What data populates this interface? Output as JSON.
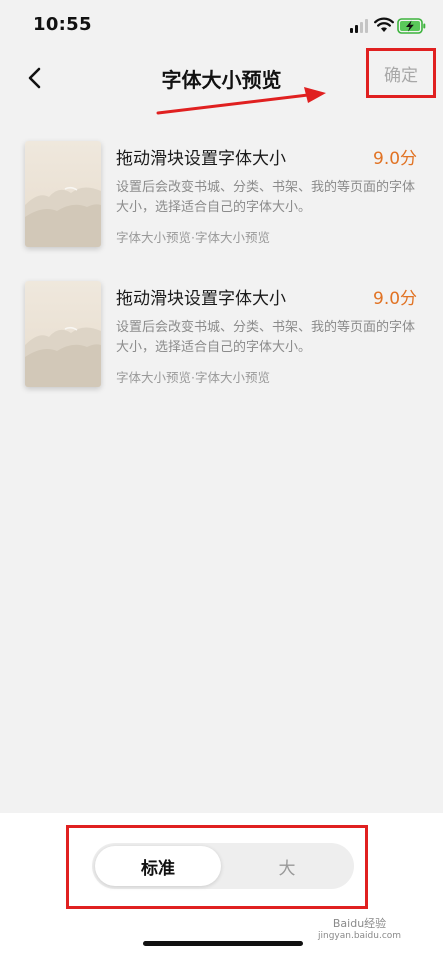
{
  "status_bar": {
    "time": "10:55"
  },
  "nav": {
    "title": "字体大小预览",
    "confirm_label": "确定"
  },
  "books": [
    {
      "title": "拖动滑块设置字体大小",
      "score": "9.0分",
      "desc": "设置后会改变书城、分类、书架、我的等页面的字体大小，选择适合自己的字体大小。",
      "meta": "字体大小预览·字体大小预览"
    },
    {
      "title": "拖动滑块设置字体大小",
      "score": "9.0分",
      "desc": "设置后会改变书城、分类、书架、我的等页面的字体大小，选择适合自己的字体大小。",
      "meta": "字体大小预览·字体大小预览"
    }
  ],
  "font_size_control": {
    "options": [
      "标准",
      "大"
    ],
    "selected": "标准"
  },
  "watermark": {
    "brand": "Baidu经验",
    "url": "jingyan.baidu.com"
  },
  "colors": {
    "accent_orange": "#e17324",
    "annotation_red": "#e02020"
  }
}
